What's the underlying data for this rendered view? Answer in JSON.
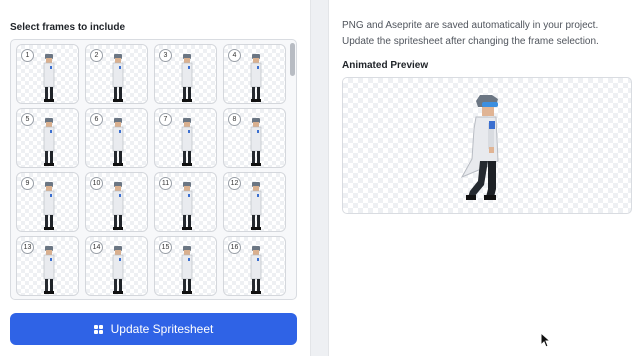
{
  "left": {
    "section_title": "Select frames to include",
    "frames": [
      {
        "number": "1"
      },
      {
        "number": "2"
      },
      {
        "number": "3"
      },
      {
        "number": "4"
      },
      {
        "number": "5"
      },
      {
        "number": "6"
      },
      {
        "number": "7"
      },
      {
        "number": "8"
      },
      {
        "number": "9"
      },
      {
        "number": "10"
      },
      {
        "number": "11"
      },
      {
        "number": "12"
      },
      {
        "number": "13"
      },
      {
        "number": "14"
      },
      {
        "number": "15"
      },
      {
        "number": "16"
      }
    ],
    "update_button_label": "Update Spritesheet"
  },
  "right": {
    "info_text": "PNG and Aseprite are saved automatically in your project. Update the spritesheet after changing the frame selection.",
    "preview_title": "Animated Preview"
  },
  "colors": {
    "accent": "#2f63e6",
    "background": "#eef0f3"
  },
  "icons": {
    "button_icon": "grid-icon",
    "cursor": "mouse-pointer-icon"
  }
}
